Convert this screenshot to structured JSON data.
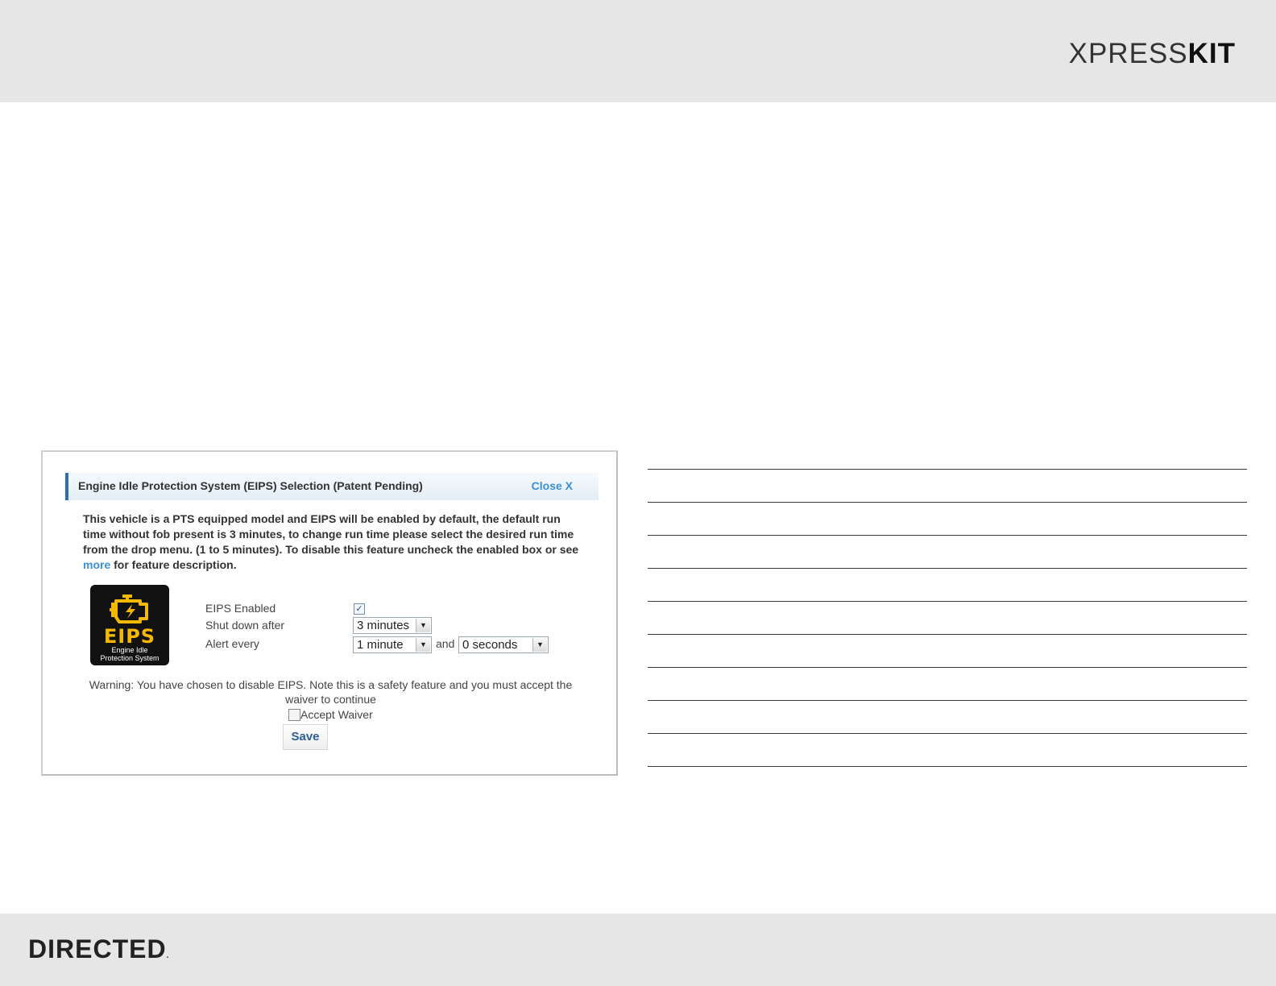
{
  "header": {
    "logo_thin": "XPRESS",
    "logo_bold": "KIT"
  },
  "footer": {
    "logo": "DIRECTED",
    "logo_mark": "."
  },
  "dialog": {
    "title": "Engine Idle Protection System (EIPS) Selection (Patent Pending)",
    "close_label": "Close X",
    "description_part1": "This vehicle is a PTS equipped model and EIPS will be enabled by default, the default run time without fob present is 3 minutes, to change run time please select the desired run time from the drop menu. (1 to 5 minutes). To disable this feature uncheck the enabled box or see ",
    "description_link": "more",
    "description_part2": " for feature description.",
    "logo_word": "EIPS",
    "logo_sub_line1": "Engine Idle",
    "logo_sub_line2": "Protection System",
    "eips_enabled_label": "EIPS Enabled",
    "eips_enabled_checked": true,
    "eips_enabled_mark": "✓",
    "shutdown_label": "Shut down after",
    "shutdown_value": "3 minutes",
    "alert_label": "Alert every",
    "alert_minutes_value": "1 minute",
    "and_label": "and",
    "alert_seconds_value": "0 seconds",
    "dropdown_arrow": "▼",
    "warning_text": "Warning: You have chosen to disable EIPS. Note this is a safety feature and you must accept the waiver to continue",
    "accept_waiver_label": "Accept Waiver",
    "accept_waiver_checked": false,
    "save_label": "Save"
  },
  "colors": {
    "band": "#e6e6e6",
    "link": "#3a8fd6",
    "header_accent": "#2a6fb1",
    "eips_yellow": "#f5b800"
  }
}
